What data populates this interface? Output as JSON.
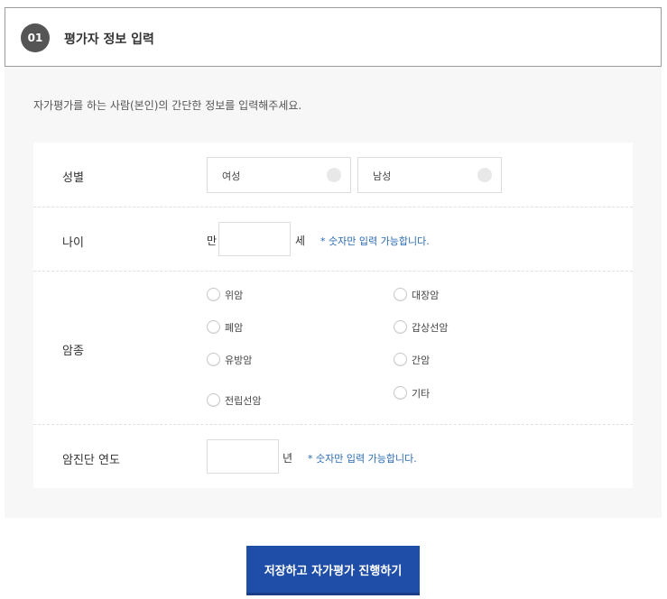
{
  "header": {
    "step": "01",
    "title": "평가자 정보 입력"
  },
  "intro": "자가평가를 하는 사람(본인)의 간단한 정보를 입력해주세요.",
  "gender": {
    "label": "성별",
    "options": [
      "여성",
      "남성"
    ]
  },
  "age": {
    "label": "나이",
    "prefix": "만",
    "suffix": "세",
    "value": "",
    "hint": "* 숫자만 입력 가능합니다."
  },
  "cancer": {
    "label": "암종",
    "options": [
      "위암",
      "폐암",
      "유방암",
      "전립선암",
      "대장암",
      "갑상선암",
      "간암",
      "기타"
    ]
  },
  "diagnosis_year": {
    "label": "암진단 연도",
    "suffix": "년",
    "value": "",
    "hint": "* 숫자만 입력 가능합니다."
  },
  "submit": {
    "label": "저장하고 자가평가 진행하기"
  }
}
